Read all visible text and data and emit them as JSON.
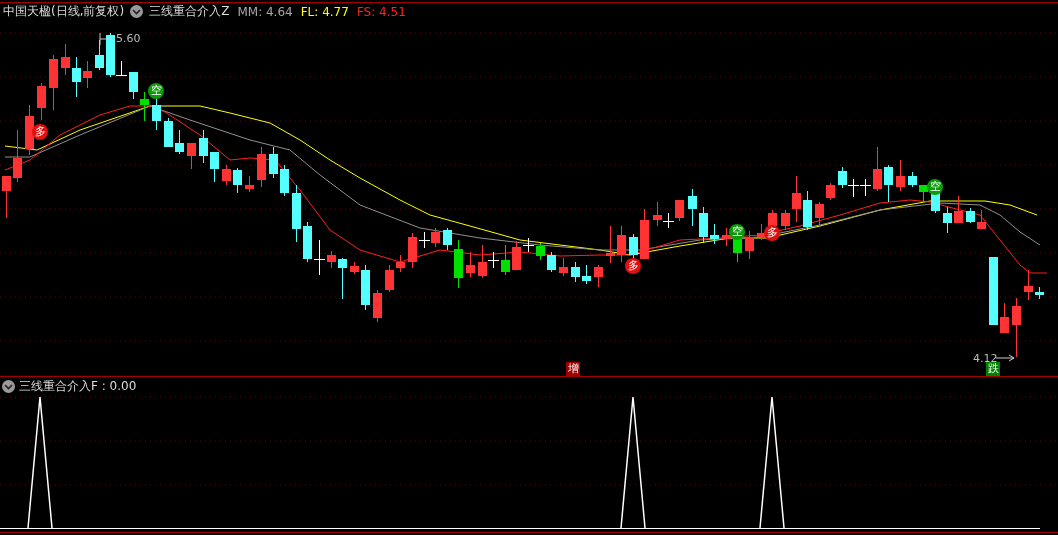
{
  "header": {
    "title": "中国天楹(日线,前复权)",
    "indicator": "三线重合介入Z",
    "values": [
      {
        "label": "MM: 4.64",
        "color": "#a8a8a8"
      },
      {
        "label": "FL: 4.77",
        "color": "#ffff00"
      },
      {
        "label": "FS: 4.51",
        "color": "#ff2020"
      }
    ]
  },
  "price_chart": {
    "high_label": "5.60",
    "low_label": "4.12",
    "signals": [
      {
        "kind": "long",
        "text": "多"
      },
      {
        "kind": "short",
        "text": "空"
      },
      {
        "kind": "long",
        "text": "多"
      },
      {
        "kind": "short",
        "text": "空"
      },
      {
        "kind": "long",
        "text": "多"
      },
      {
        "kind": "short",
        "text": "空"
      }
    ],
    "events": [
      {
        "kind": "increase",
        "text": "增"
      },
      {
        "kind": "decrease",
        "text": "跌"
      }
    ]
  },
  "indicator_pane": {
    "title": "三线重合介入F : 0.00"
  }
}
